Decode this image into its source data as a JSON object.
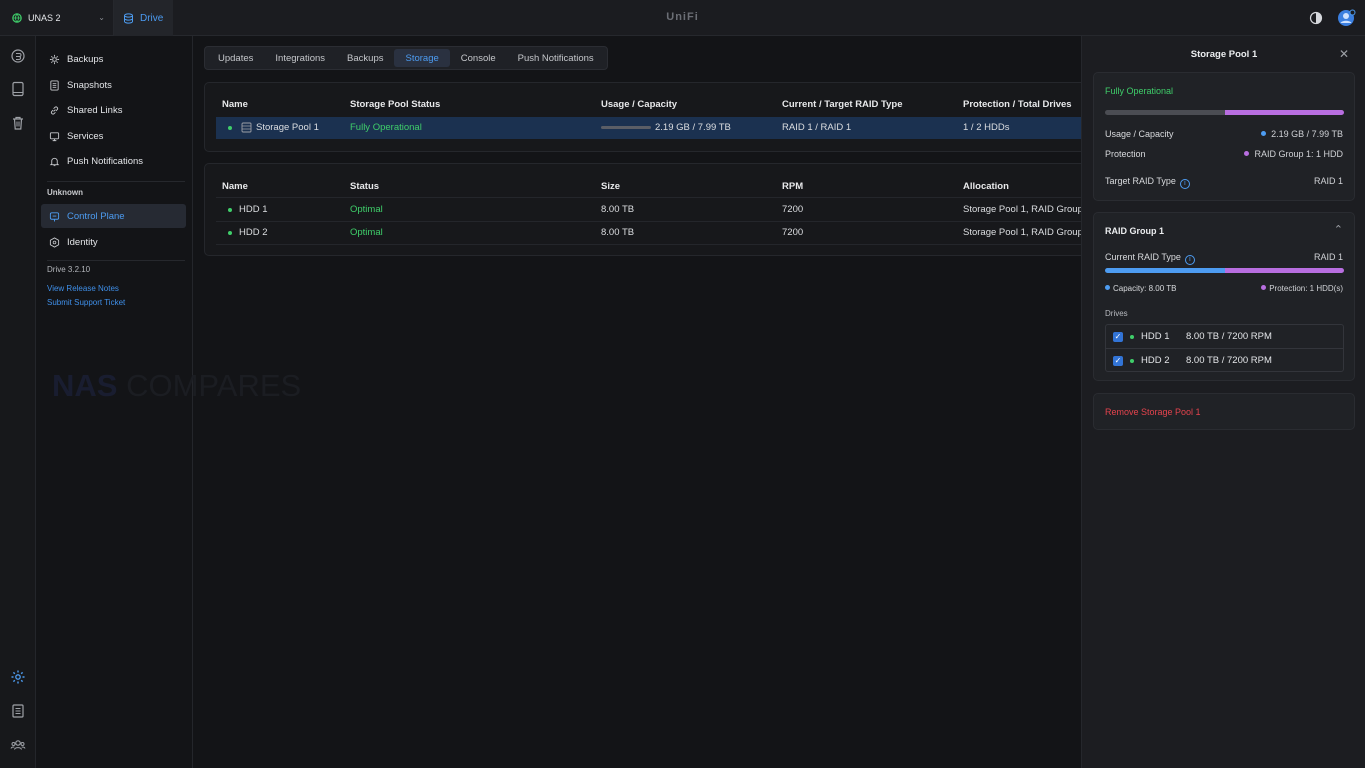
{
  "topbar": {
    "console_name": "UNAS 2",
    "app_name": "Drive",
    "brand": "UniFi"
  },
  "sidebar": {
    "items": [
      {
        "label": "Backups",
        "icon": "backup-icon"
      },
      {
        "label": "Snapshots",
        "icon": "snapshot-icon"
      },
      {
        "label": "Shared Links",
        "icon": "link-icon"
      },
      {
        "label": "Services",
        "icon": "services-icon"
      },
      {
        "label": "Push Notifications",
        "icon": "bell-icon"
      }
    ],
    "section_header": "Unknown",
    "section_items": [
      {
        "label": "Control Plane",
        "icon": "control-plane-icon",
        "active": true
      },
      {
        "label": "Identity",
        "icon": "identity-icon"
      }
    ],
    "version": "Drive 3.2.10",
    "release_notes": "View Release Notes",
    "support_ticket": "Submit Support Ticket"
  },
  "watermark": {
    "part1": "NAS",
    "part2": "COMPARES"
  },
  "tabs": [
    {
      "label": "Updates"
    },
    {
      "label": "Integrations"
    },
    {
      "label": "Backups"
    },
    {
      "label": "Storage",
      "active": true
    },
    {
      "label": "Console"
    },
    {
      "label": "Push Notifications"
    }
  ],
  "pools_table": {
    "headers": [
      "Name",
      "Storage Pool Status",
      "Usage / Capacity",
      "Current / Target RAID Type",
      "Protection / Total Drives"
    ],
    "rows": [
      {
        "name": "Storage Pool 1",
        "status": "Fully Operational",
        "usage": "2.19 GB / 7.99 TB",
        "raid": "RAID 1 / RAID 1",
        "protection": "1 / 2 HDDs",
        "usage_fraction": 0.0003
      }
    ]
  },
  "drives_table": {
    "headers": [
      "Name",
      "Status",
      "Size",
      "RPM",
      "Allocation"
    ],
    "rows": [
      {
        "name": "HDD 1",
        "status": "Optimal",
        "size": "8.00 TB",
        "rpm": "7200",
        "allocation": "Storage Pool 1, RAID Group"
      },
      {
        "name": "HDD 2",
        "status": "Optimal",
        "size": "8.00 TB",
        "rpm": "7200",
        "allocation": "Storage Pool 1, RAID Group"
      }
    ]
  },
  "drawer": {
    "title": "Storage Pool 1",
    "summary": {
      "status": "Fully Operational",
      "usage_label": "Usage / Capacity",
      "usage_value": "2.19 GB / 7.99 TB",
      "protection_label": "Protection",
      "protection_value": "RAID Group 1: 1 HDD",
      "target_raid_label": "Target RAID Type",
      "target_raid_value": "RAID 1",
      "bar_capacity_fraction": 0.5,
      "bar_protection_fraction": 0.5
    },
    "raid_group": {
      "title": "RAID Group 1",
      "current_raid_label": "Current RAID Type",
      "current_raid_value": "RAID 1",
      "capacity_legend": "Capacity: 8.00 TB",
      "protection_legend": "Protection: 1 HDD(s)",
      "drives_label": "Drives",
      "drives": [
        {
          "name": "HDD 1",
          "detail": "8.00 TB / 7200 RPM",
          "checked": true
        },
        {
          "name": "HDD 2",
          "detail": "8.00 TB / 7200 RPM",
          "checked": true
        }
      ]
    },
    "remove_label": "Remove Storage Pool 1"
  },
  "colors": {
    "accent": "#4d9cf1",
    "success": "#3fce6a",
    "protection": "#b86ee0",
    "capacity": "#4d9cf1",
    "danger": "#e4434d"
  }
}
